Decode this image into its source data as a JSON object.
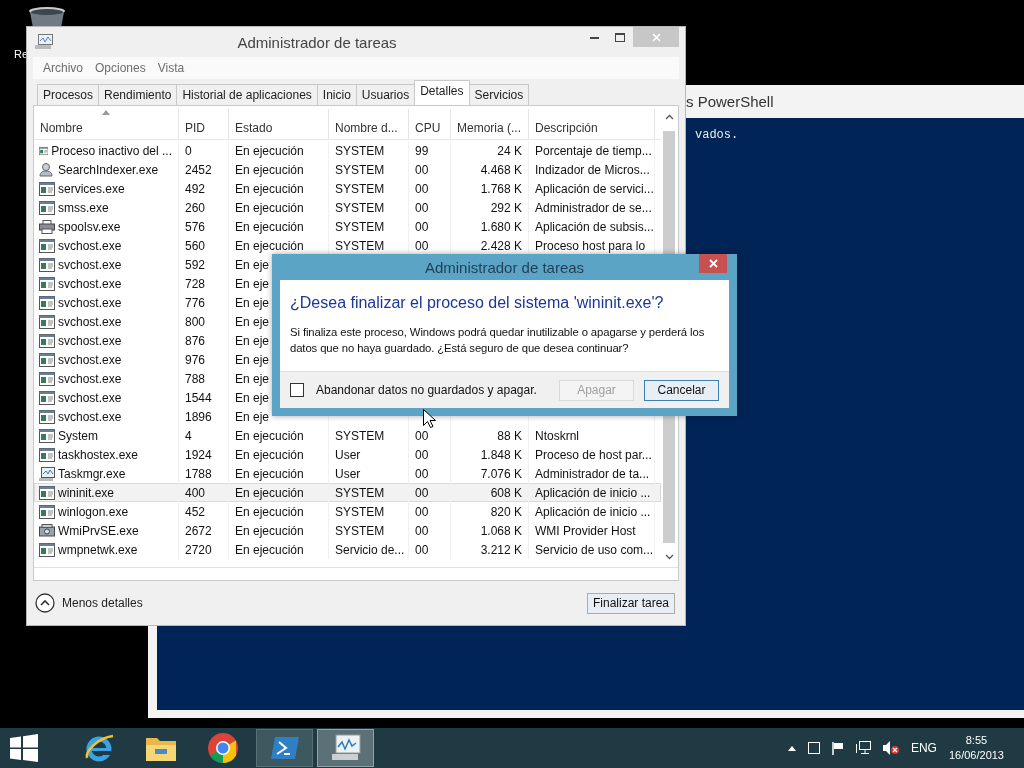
{
  "desktop": {
    "icons": [
      {
        "label": "Re"
      }
    ]
  },
  "background_window": {
    "title": "s PowerShell",
    "console_lines": [
      "vados."
    ]
  },
  "task_manager": {
    "title": "Administrador de tareas",
    "menu": [
      "Archivo",
      "Opciones",
      "Vista"
    ],
    "tabs": [
      {
        "label": "Procesos",
        "selected": false
      },
      {
        "label": "Rendimiento",
        "selected": false
      },
      {
        "label": "Historial de aplicaciones",
        "selected": false
      },
      {
        "label": "Inicio",
        "selected": false
      },
      {
        "label": "Usuarios",
        "selected": false
      },
      {
        "label": "Detalles",
        "selected": true
      },
      {
        "label": "Servicios",
        "selected": false
      }
    ],
    "columns": [
      {
        "label": "Nombre",
        "sorted": true
      },
      {
        "label": "PID",
        "sorted": false
      },
      {
        "label": "Estado",
        "sorted": false
      },
      {
        "label": "Nombre d...",
        "sorted": false
      },
      {
        "label": "CPU",
        "sorted": false
      },
      {
        "label": "Memoria (...",
        "sorted": false
      },
      {
        "label": "Descripción",
        "sorted": false
      }
    ],
    "rows": [
      {
        "kind": "app",
        "name": "Proceso inactivo del ...",
        "pid": "0",
        "status": "En ejecución",
        "user": "SYSTEM",
        "cpu": "99",
        "memory": "24 K",
        "description": "Porcentaje de tiemp...",
        "selected": false
      },
      {
        "kind": "search",
        "name": "SearchIndexer.exe",
        "pid": "2452",
        "status": "En ejecución",
        "user": "SYSTEM",
        "cpu": "00",
        "memory": "4.468 K",
        "description": "Indizador de Micros...",
        "selected": false
      },
      {
        "kind": "app",
        "name": "services.exe",
        "pid": "492",
        "status": "En ejecución",
        "user": "SYSTEM",
        "cpu": "00",
        "memory": "1.768 K",
        "description": "Aplicación de servici...",
        "selected": false
      },
      {
        "kind": "app",
        "name": "smss.exe",
        "pid": "260",
        "status": "En ejecución",
        "user": "SYSTEM",
        "cpu": "00",
        "memory": "292 K",
        "description": "Administrador de se...",
        "selected": false
      },
      {
        "kind": "printer",
        "name": "spoolsv.exe",
        "pid": "576",
        "status": "En ejecución",
        "user": "SYSTEM",
        "cpu": "00",
        "memory": "1.680 K",
        "description": "Aplicación de subsis...",
        "selected": false
      },
      {
        "kind": "app",
        "name": "svchost.exe",
        "pid": "560",
        "status": "En ejecución",
        "user": "SYSTEM",
        "cpu": "00",
        "memory": "2.428 K",
        "description": "Proceso host para lo",
        "selected": false
      },
      {
        "kind": "app",
        "name": "svchost.exe",
        "pid": "592",
        "status": "En eje",
        "selected": false
      },
      {
        "kind": "app",
        "name": "svchost.exe",
        "pid": "728",
        "status": "En eje",
        "selected": false
      },
      {
        "kind": "app",
        "name": "svchost.exe",
        "pid": "776",
        "status": "En eje",
        "selected": false
      },
      {
        "kind": "app",
        "name": "svchost.exe",
        "pid": "800",
        "status": "En eje",
        "selected": false
      },
      {
        "kind": "app",
        "name": "svchost.exe",
        "pid": "876",
        "status": "En eje",
        "selected": false
      },
      {
        "kind": "app",
        "name": "svchost.exe",
        "pid": "976",
        "status": "En eje",
        "selected": false
      },
      {
        "kind": "app",
        "name": "svchost.exe",
        "pid": "788",
        "status": "En eje",
        "selected": false
      },
      {
        "kind": "app",
        "name": "svchost.exe",
        "pid": "1544",
        "status": "En eje",
        "selected": false
      },
      {
        "kind": "app",
        "name": "svchost.exe",
        "pid": "1896",
        "status": "En eje",
        "selected": false
      },
      {
        "kind": "app",
        "name": "System",
        "pid": "4",
        "status": "En ejecución",
        "user": "SYSTEM",
        "cpu": "00",
        "memory": "88 K",
        "description": "Ntoskrnl",
        "selected": false
      },
      {
        "kind": "app",
        "name": "taskhostex.exe",
        "pid": "1924",
        "status": "En ejecución",
        "user": "User",
        "cpu": "00",
        "memory": "1.848 K",
        "description": "Proceso de host par...",
        "selected": false
      },
      {
        "kind": "monitor",
        "name": "Taskmgr.exe",
        "pid": "1788",
        "status": "En ejecución",
        "user": "User",
        "cpu": "00",
        "memory": "7.076 K",
        "description": "Administrador de ta...",
        "selected": false
      },
      {
        "kind": "app",
        "name": "wininit.exe",
        "pid": "400",
        "status": "En ejecución",
        "user": "SYSTEM",
        "cpu": "00",
        "memory": "608 K",
        "description": "Aplicación de inicio ...",
        "selected": true
      },
      {
        "kind": "app",
        "name": "winlogon.exe",
        "pid": "452",
        "status": "En ejecución",
        "user": "SYSTEM",
        "cpu": "00",
        "memory": "820 K",
        "description": "Aplicación de inicio ...",
        "selected": false
      },
      {
        "kind": "wmi",
        "name": "WmiPrvSE.exe",
        "pid": "2672",
        "status": "En ejecución",
        "user": "SYSTEM",
        "cpu": "00",
        "memory": "1.068 K",
        "description": "WMI Provider Host",
        "selected": false
      },
      {
        "kind": "app",
        "name": "wmpnetwk.exe",
        "pid": "2720",
        "status": "En ejecución",
        "user": "Servicio de...",
        "cpu": "00",
        "memory": "3.212 K",
        "description": "Servicio de uso com...",
        "selected": false
      }
    ],
    "footer": {
      "toggle": "Menos detalles",
      "end_task": "Finalizar tarea"
    }
  },
  "dialog": {
    "title": "Administrador de tareas",
    "heading": "¿Desea finalizar el proceso del sistema 'wininit.exe'?",
    "message": "Si finaliza este proceso, Windows podrá quedar inutilizable o apagarse y perderá los datos que no haya guardado. ¿Está seguro de que desea continuar?",
    "checkbox": {
      "label": "Abandonar datos no guardados y apagar.",
      "checked": false
    },
    "buttons": [
      {
        "label": "Apagar",
        "disabled": true
      },
      {
        "label": "Cancelar",
        "disabled": false
      }
    ]
  },
  "taskbar": {
    "apps": [
      {
        "kind": "ie",
        "running": false,
        "selected": false
      },
      {
        "kind": "explorer",
        "running": false,
        "selected": false
      },
      {
        "kind": "chrome",
        "running": false,
        "selected": false
      },
      {
        "kind": "powershell",
        "running": true,
        "selected": false
      },
      {
        "kind": "taskmgr",
        "running": true,
        "selected": true
      }
    ],
    "language": "ENG",
    "time": "8:55",
    "date": "16/06/2013"
  }
}
